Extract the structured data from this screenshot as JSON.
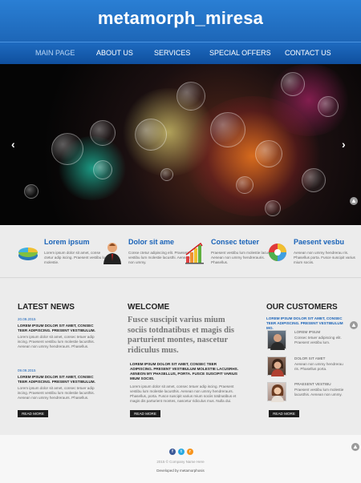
{
  "site": {
    "title": "metamorph_miresa"
  },
  "nav": {
    "items": [
      {
        "label": "MAIN PAGE",
        "active": true
      },
      {
        "label": "ABOUT US"
      },
      {
        "label": "SERVICES"
      },
      {
        "label": "SPECIAL OFFERS"
      },
      {
        "label": "CONTACT US"
      }
    ]
  },
  "slider": {
    "prev_icon": "chevron-left-icon",
    "next_icon": "chevron-right-icon",
    "prev_glyph": "‹",
    "next_glyph": "›"
  },
  "features": [
    {
      "title": "Lorem ipsum",
      "text": "Lorem ipsum dolor sit amet, conse ctetur adip iscing. Praesent vestibu lum molestie.",
      "icon": "pie-chart-icon"
    },
    {
      "title": "Dolor sit ame",
      "text": "Conse ctetur adipiscing elit. Praesent vestibu lum molestie lacusthi. Aenean non ummy.",
      "icon": "user-icon"
    },
    {
      "title": "Consec tetuer",
      "text": "Praesent vestibu lum molestie lacusthis. Aenean non ummy hendrerauris. Phasellus.",
      "icon": "bar-chart-icon"
    },
    {
      "title": "Paesent vesbu",
      "text": "Aenean non ummy hendrerau ris. Phasellus porta. Fusce suscipit varius mium sociis.",
      "icon": "color-wheel-icon"
    }
  ],
  "news": {
    "heading": "LATEST NEWS",
    "items": [
      {
        "date": "20.09.2015",
        "caption": "LOREM IPSUM DOLOR SIT AMET, CONSEC TEER ADIPISCING. PRESENT VESTIBULUM.",
        "text": "Lorem ipsum dolor sit amet, consec tetuer adip iscing. Praesent vestibu lum molestie lacusthis. Aenean non ummy hendreraurs. Phasellus."
      },
      {
        "date": "09.09.2015",
        "caption": "LOREM IPSUM DOLOR SIT AMET, CONSEC TEER ADIPISCING. PRESENT VESTIBULUM.",
        "text": "Lorem ipsum dolor sit amet, consec tetuer adip iscing. Praesent vestibu lum molestie lacusthis. Aenean non ummy hendreraurs. Phasellus."
      }
    ],
    "read_more": "READ MORE"
  },
  "welcome": {
    "heading": "WELCOME",
    "lead": "Fusce suscipit varius mium sociis totdnatibus et magis dis parturient montes, nascetur ridiculus mus.",
    "caption": "LOREM IPSUM DOLOR SIT AMET, CONSEC TEER ADIPISCING. PRESENT VESTIBULUM MOLESTIE LACUSRHS. AENEON MY PHASELLUS, PORTA. FUSCE SUSCIPIT VARIUS MIUM SOCIIS.",
    "text": "Lorem ipsum dolor sit amet, consec tetuer adip iscing. Praesent vestibu lum molestie lacusthis. Aenean non ummy hendreraurs. Phasellus, porta. Fusce suscipit varius mium sociis totdnatibus et magis dis parturient montes, nascetur ridiculus mus. Nulla dui.",
    "read_more": "READ MORE"
  },
  "customers": {
    "heading": "OUR CUSTOMERS",
    "caption": "LOREM IPSUM DOLOR SIT AMET, CONSEC TEER ADIPISCING. PRESENT VESTIBULUM MO.",
    "items": [
      {
        "name": "LOREM IPSUM",
        "text": "Consec tetuer adipiscing elit. Praesent vestibu lum."
      },
      {
        "name": "DOLOR SIT AMET",
        "text": "Aenean non ummy hendrerau ris. Phasellus porta."
      },
      {
        "name": "PRAESENT VESTIBU",
        "text": "Praesent vestibu lum molestie lacusthis. Aenean non ummy."
      }
    ],
    "read_more": "READ MORE"
  },
  "footer": {
    "social": [
      {
        "icon": "facebook-icon",
        "glyph": "f",
        "color": "#3b5998"
      },
      {
        "icon": "twitter-icon",
        "glyph": "t",
        "color": "#29a9e1"
      },
      {
        "icon": "rss-icon",
        "glyph": "r",
        "color": "#f7941d"
      }
    ],
    "copyright": "2015 © Company Name Here",
    "developed": "Developed by metamorphosis"
  },
  "colors": {
    "accent": "#1a63b8",
    "header": "#1e6bc0"
  }
}
